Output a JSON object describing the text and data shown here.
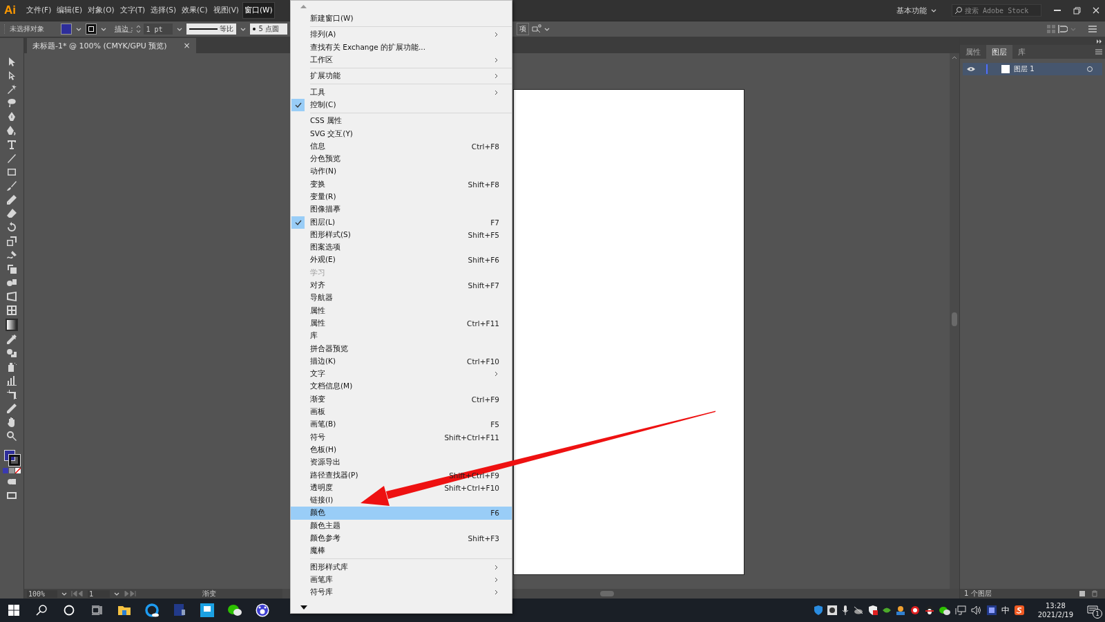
{
  "menubar": {
    "logo": "Ai",
    "items": [
      {
        "label": "文件(F)",
        "selected": false
      },
      {
        "label": "编辑(E)",
        "selected": false
      },
      {
        "label": "对象(O)",
        "selected": false
      },
      {
        "label": "文字(T)",
        "selected": false
      },
      {
        "label": "选择(S)",
        "selected": false
      },
      {
        "label": "效果(C)",
        "selected": false
      },
      {
        "label": "视图(V)",
        "selected": false
      },
      {
        "label": "窗口(W)",
        "selected": true
      }
    ]
  },
  "top_right": {
    "workspace": "基本功能",
    "search_placeholder": "搜索 Adobe Stock"
  },
  "control_bar": {
    "selection": "未选择对象",
    "stroke_label": "描边 :",
    "stroke_weight": "1 pt",
    "stroke_profile": "等比",
    "brush": "5 点圆",
    "options": "项"
  },
  "document_tab": {
    "title": "未标题-1* @ 100% (CMYK/GPU 预览)",
    "close": "×"
  },
  "window_menu": {
    "items": [
      {
        "kind": "item",
        "label": "新建窗口(W)",
        "submenu": false,
        "checked": false,
        "disabled": false,
        "selected": false
      },
      {
        "kind": "separator"
      },
      {
        "kind": "item",
        "label": "排列(A)",
        "submenu": true,
        "checked": false,
        "disabled": false,
        "selected": false
      },
      {
        "kind": "item",
        "label": "查找有关 Exchange 的扩展功能...",
        "submenu": false,
        "checked": false,
        "disabled": false,
        "selected": false
      },
      {
        "kind": "item",
        "label": "工作区",
        "submenu": true,
        "checked": false,
        "disabled": false,
        "selected": false
      },
      {
        "kind": "separator"
      },
      {
        "kind": "item",
        "label": "扩展功能",
        "submenu": true,
        "checked": false,
        "disabled": false,
        "selected": false
      },
      {
        "kind": "separator"
      },
      {
        "kind": "item",
        "label": "工具",
        "submenu": true,
        "checked": false,
        "disabled": false,
        "selected": false
      },
      {
        "kind": "item",
        "label": "控制(C)",
        "submenu": false,
        "checked": true,
        "disabled": false,
        "selected": false
      },
      {
        "kind": "separator"
      },
      {
        "kind": "item",
        "label": "CSS 属性",
        "submenu": false,
        "checked": false,
        "disabled": false,
        "selected": false
      },
      {
        "kind": "item",
        "label": "SVG 交互(Y)",
        "submenu": false,
        "checked": false,
        "disabled": false,
        "selected": false
      },
      {
        "kind": "item",
        "label": "信息",
        "shortcut": "Ctrl+F8",
        "submenu": false,
        "checked": false,
        "disabled": false,
        "selected": false
      },
      {
        "kind": "item",
        "label": "分色预览",
        "submenu": false,
        "checked": false,
        "disabled": false,
        "selected": false
      },
      {
        "kind": "item",
        "label": "动作(N)",
        "submenu": false,
        "checked": false,
        "disabled": false,
        "selected": false
      },
      {
        "kind": "item",
        "label": "变换",
        "shortcut": "Shift+F8",
        "submenu": false,
        "checked": false,
        "disabled": false,
        "selected": false
      },
      {
        "kind": "item",
        "label": "变量(R)",
        "submenu": false,
        "checked": false,
        "disabled": false,
        "selected": false
      },
      {
        "kind": "item",
        "label": "图像描摹",
        "submenu": false,
        "checked": false,
        "disabled": false,
        "selected": false
      },
      {
        "kind": "item",
        "label": "图层(L)",
        "shortcut": "F7",
        "submenu": false,
        "checked": true,
        "disabled": false,
        "selected": false
      },
      {
        "kind": "item",
        "label": "图形样式(S)",
        "shortcut": "Shift+F5",
        "submenu": false,
        "checked": false,
        "disabled": false,
        "selected": false
      },
      {
        "kind": "item",
        "label": "图案选项",
        "submenu": false,
        "checked": false,
        "disabled": false,
        "selected": false
      },
      {
        "kind": "item",
        "label": "外观(E)",
        "shortcut": "Shift+F6",
        "submenu": false,
        "checked": false,
        "disabled": false,
        "selected": false
      },
      {
        "kind": "item",
        "label": "学习",
        "submenu": false,
        "checked": false,
        "disabled": true,
        "selected": false
      },
      {
        "kind": "item",
        "label": "对齐",
        "shortcut": "Shift+F7",
        "submenu": false,
        "checked": false,
        "disabled": false,
        "selected": false
      },
      {
        "kind": "item",
        "label": "导航器",
        "submenu": false,
        "checked": false,
        "disabled": false,
        "selected": false
      },
      {
        "kind": "item",
        "label": "属性",
        "submenu": false,
        "checked": false,
        "disabled": false,
        "selected": false
      },
      {
        "kind": "item",
        "label": "属性",
        "shortcut": "Ctrl+F11",
        "submenu": false,
        "checked": false,
        "disabled": false,
        "selected": false
      },
      {
        "kind": "item",
        "label": "库",
        "submenu": false,
        "checked": false,
        "disabled": false,
        "selected": false
      },
      {
        "kind": "item",
        "label": "拼合器预览",
        "submenu": false,
        "checked": false,
        "disabled": false,
        "selected": false
      },
      {
        "kind": "item",
        "label": "描边(K)",
        "shortcut": "Ctrl+F10",
        "submenu": false,
        "checked": false,
        "disabled": false,
        "selected": false
      },
      {
        "kind": "item",
        "label": "文字",
        "submenu": true,
        "checked": false,
        "disabled": false,
        "selected": false
      },
      {
        "kind": "item",
        "label": "文档信息(M)",
        "submenu": false,
        "checked": false,
        "disabled": false,
        "selected": false
      },
      {
        "kind": "item",
        "label": "渐变",
        "shortcut": "Ctrl+F9",
        "submenu": false,
        "checked": false,
        "disabled": false,
        "selected": false
      },
      {
        "kind": "item",
        "label": "画板",
        "submenu": false,
        "checked": false,
        "disabled": false,
        "selected": false
      },
      {
        "kind": "item",
        "label": "画笔(B)",
        "shortcut": "F5",
        "submenu": false,
        "checked": false,
        "disabled": false,
        "selected": false
      },
      {
        "kind": "item",
        "label": "符号",
        "shortcut": "Shift+Ctrl+F11",
        "submenu": false,
        "checked": false,
        "disabled": false,
        "selected": false
      },
      {
        "kind": "item",
        "label": "色板(H)",
        "submenu": false,
        "checked": false,
        "disabled": false,
        "selected": false
      },
      {
        "kind": "item",
        "label": "资源导出",
        "submenu": false,
        "checked": false,
        "disabled": false,
        "selected": false
      },
      {
        "kind": "item",
        "label": "路径查找器(P)",
        "shortcut": "Shift+Ctrl+F9",
        "submenu": false,
        "checked": false,
        "disabled": false,
        "selected": false
      },
      {
        "kind": "item",
        "label": "透明度",
        "shortcut": "Shift+Ctrl+F10",
        "submenu": false,
        "checked": false,
        "disabled": false,
        "selected": false
      },
      {
        "kind": "item",
        "label": "链接(I)",
        "submenu": false,
        "checked": false,
        "disabled": false,
        "selected": false
      },
      {
        "kind": "item",
        "label": "颜色",
        "shortcut": "F6",
        "submenu": false,
        "checked": false,
        "disabled": false,
        "selected": true
      },
      {
        "kind": "item",
        "label": "颜色主题",
        "submenu": false,
        "checked": false,
        "disabled": false,
        "selected": false
      },
      {
        "kind": "item",
        "label": "颜色参考",
        "shortcut": "Shift+F3",
        "submenu": false,
        "checked": false,
        "disabled": false,
        "selected": false
      },
      {
        "kind": "item",
        "label": "魔棒",
        "submenu": false,
        "checked": false,
        "disabled": false,
        "selected": false
      },
      {
        "kind": "separator"
      },
      {
        "kind": "item",
        "label": "图形样式库",
        "submenu": true,
        "checked": false,
        "disabled": false,
        "selected": false
      },
      {
        "kind": "item",
        "label": "画笔库",
        "submenu": true,
        "checked": false,
        "disabled": false,
        "selected": false
      },
      {
        "kind": "item",
        "label": "符号库",
        "submenu": true,
        "checked": false,
        "disabled": false,
        "selected": false
      }
    ]
  },
  "panel": {
    "tabs": [
      {
        "label": "属性",
        "selected": false
      },
      {
        "label": "图层",
        "selected": true
      },
      {
        "label": "库",
        "selected": false
      }
    ],
    "layers": [
      {
        "name": "图层 1",
        "visible": true,
        "selected": true
      }
    ],
    "footer": "1 个图层"
  },
  "status_bar": {
    "zoom": "100%",
    "artboard": "1",
    "tool": "渐变"
  },
  "taskbar": {
    "ime": "中",
    "time": "13:28",
    "date": "2021/2/19",
    "notifications": "1"
  }
}
